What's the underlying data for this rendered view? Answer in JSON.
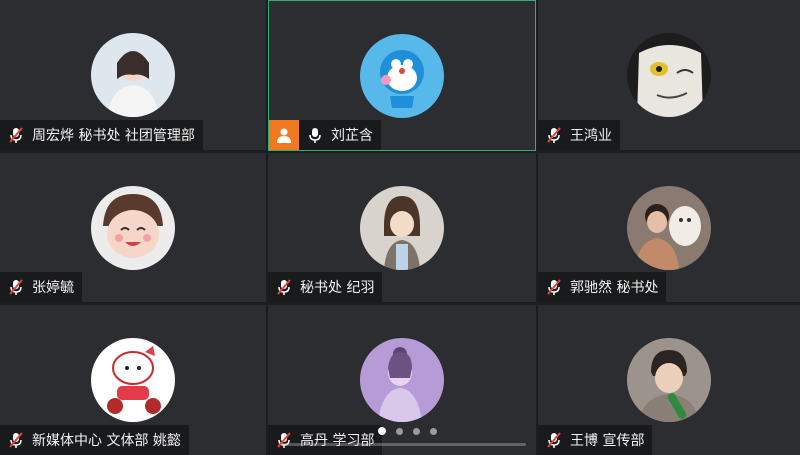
{
  "participants": [
    {
      "name": "周宏烨 秘书处 社团管理部",
      "muted": true,
      "speaking": false,
      "host": false,
      "avatar": "portrait-woman-white-sweater"
    },
    {
      "name": "刘芷含",
      "muted": false,
      "speaking": true,
      "host": true,
      "avatar": "doraemon-cartoon"
    },
    {
      "name": "王鸿业",
      "muted": true,
      "speaking": false,
      "host": false,
      "avatar": "cartoon-cat-yellow-eyes"
    },
    {
      "name": "张婷毓",
      "muted": true,
      "speaking": false,
      "host": false,
      "avatar": "smiling-child"
    },
    {
      "name": "秘书处 纪羽",
      "muted": true,
      "speaking": false,
      "host": false,
      "avatar": "child-with-bob-haircut"
    },
    {
      "name": "郭驰然 秘书处",
      "muted": true,
      "speaking": false,
      "host": false,
      "avatar": "person-holding-cat"
    },
    {
      "name": "新媒体中心 文体部 姚懿",
      "muted": true,
      "speaking": false,
      "host": false,
      "avatar": "hello-kitty-on-scooter"
    },
    {
      "name": "高丹 学习部",
      "muted": true,
      "speaking": false,
      "host": false,
      "avatar": "girl-purple-tone"
    },
    {
      "name": "王博 宣传部",
      "muted": true,
      "speaking": false,
      "host": false,
      "avatar": "young-man-with-bottle"
    }
  ],
  "pagination": {
    "pages": 4,
    "current": 1
  },
  "colors": {
    "speaking_border": "#2fb06b",
    "host_badge": "#f07a22",
    "mute_red": "#e0453a"
  }
}
